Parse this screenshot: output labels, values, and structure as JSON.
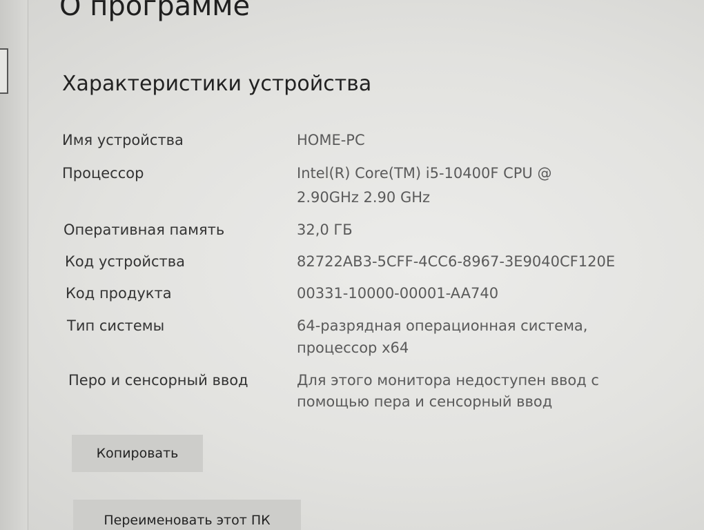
{
  "page": {
    "title": "О программе"
  },
  "device_specs": {
    "heading": "Характеристики устройства",
    "rows": [
      {
        "label": "Имя устройства",
        "value_lines": [
          "HOME-PC"
        ]
      },
      {
        "label": "Процессор",
        "value_lines": [
          "Intel(R) Core(TM) i5-10400F CPU @",
          "2.90GHz   2.90 GHz"
        ]
      },
      {
        "label": "Оперативная память",
        "value_lines": [
          "32,0 ГБ"
        ]
      },
      {
        "label": "Код устройства",
        "value_lines": [
          "82722AB3-5CFF-4CC6-8967-3E9040CF120E"
        ]
      },
      {
        "label": "Код продукта",
        "value_lines": [
          "00331-10000-00001-AA740"
        ]
      },
      {
        "label": "Тип системы",
        "value_lines": [
          "64-разрядная операционная система,",
          "процессор x64"
        ]
      },
      {
        "label": "Перо и сенсорный ввод",
        "value_lines": [
          "Для этого монитора недоступен ввод с",
          "помощью пера и сенсорный ввод"
        ]
      }
    ],
    "copy_button": "Копировать",
    "rename_button": "Переименовать этот ПК"
  }
}
